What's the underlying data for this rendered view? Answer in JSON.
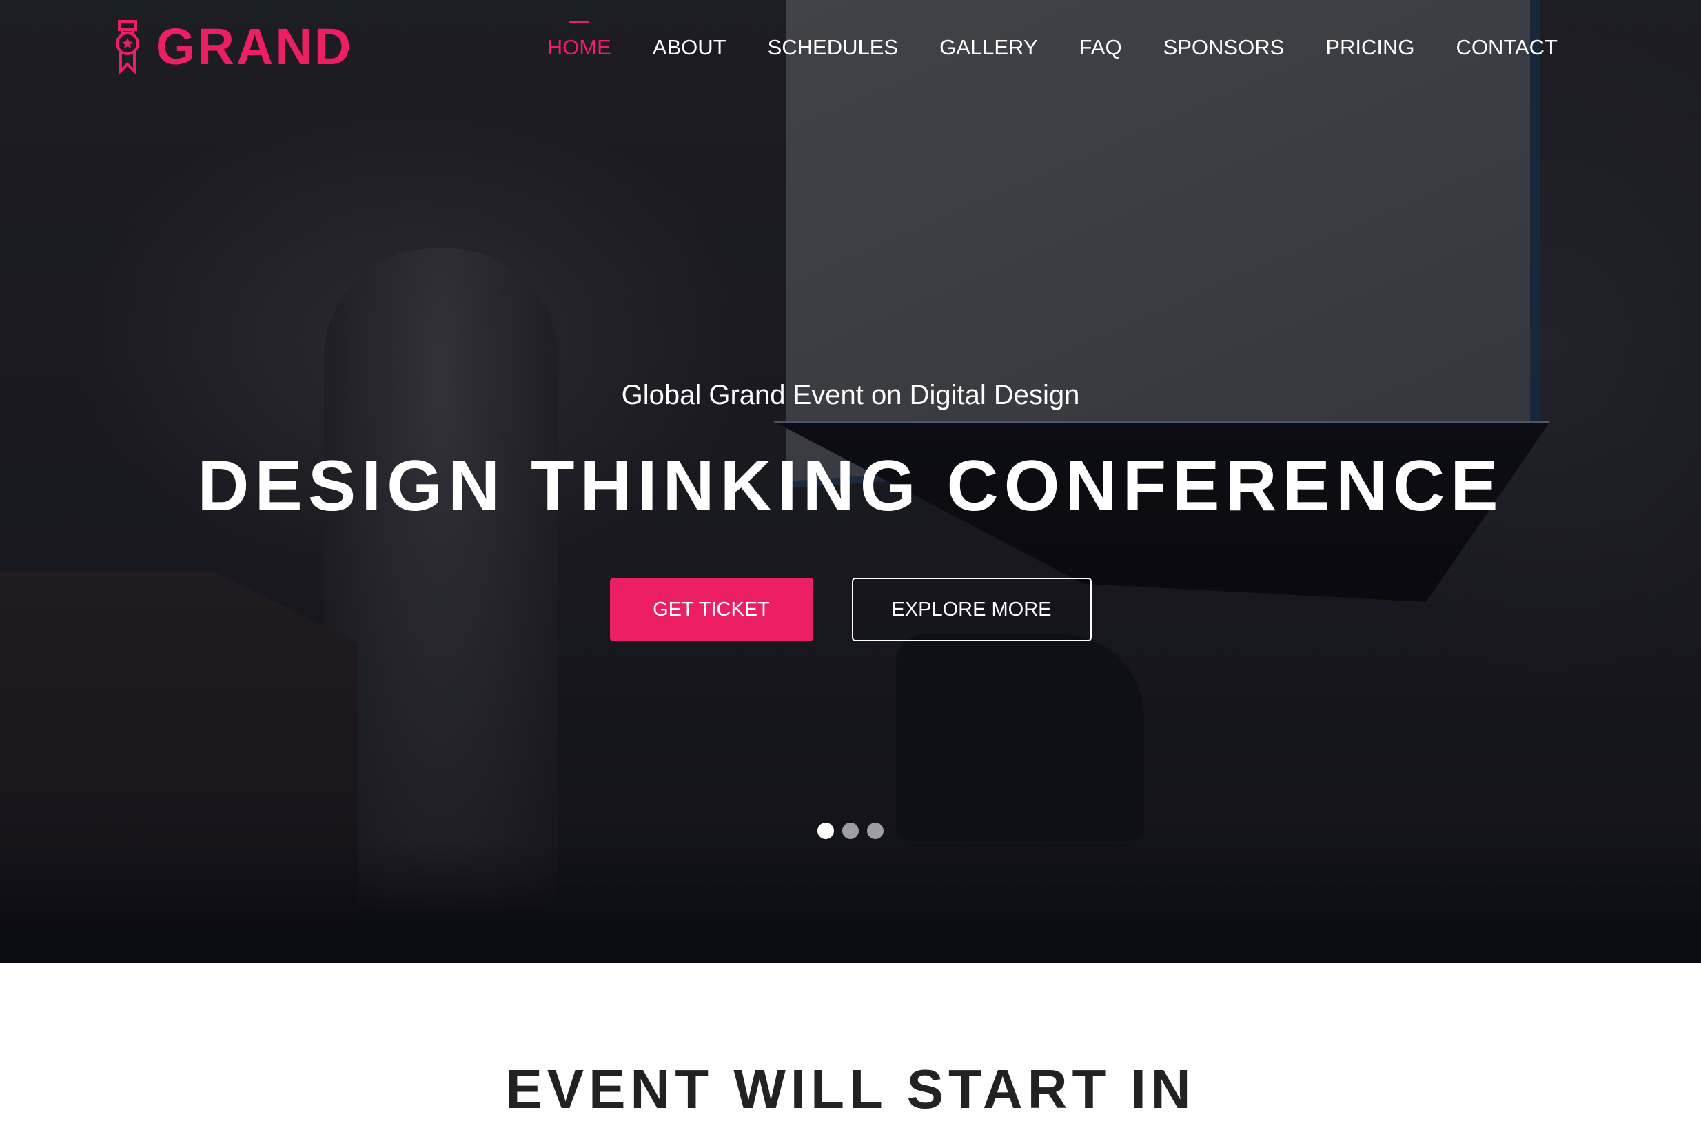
{
  "brand": {
    "name": "GRAND",
    "icon": "award-ribbon-icon",
    "accent_color": "#ec1f64"
  },
  "nav": {
    "items": [
      {
        "label": "HOME",
        "active": true
      },
      {
        "label": "ABOUT",
        "active": false
      },
      {
        "label": "SCHEDULES",
        "active": false
      },
      {
        "label": "GALLERY",
        "active": false
      },
      {
        "label": "FAQ",
        "active": false
      },
      {
        "label": "SPONSORS",
        "active": false
      },
      {
        "label": "PRICING",
        "active": false
      },
      {
        "label": "CONTACT",
        "active": false
      }
    ]
  },
  "hero": {
    "subtitle": "Global Grand Event on Digital Design",
    "title": "DESIGN THINKING CONFERENCE",
    "primary_button": "GET TICKET",
    "secondary_button": "EXPLORE MORE",
    "slider": {
      "total_slides": 3,
      "active_slide": 1
    }
  },
  "countdown_section": {
    "title": "EVENT WILL START IN"
  }
}
